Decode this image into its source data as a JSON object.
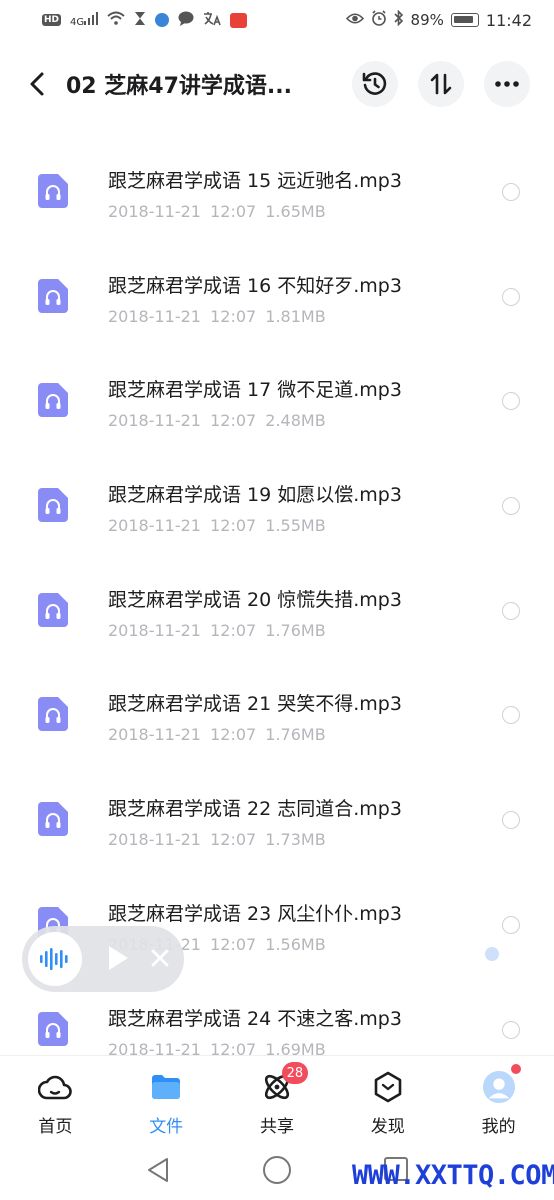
{
  "status_bar": {
    "signal_label": "4G",
    "battery": "89%",
    "time": "11:42"
  },
  "header": {
    "title": "02 芝麻47讲学成语..."
  },
  "files": [
    {
      "name": "跟芝麻君学成语 15 远近驰名.mp3",
      "date": "2018-11-21",
      "time": "12:07",
      "size": "1.65MB"
    },
    {
      "name": "跟芝麻君学成语 16 不知好歹.mp3",
      "date": "2018-11-21",
      "time": "12:07",
      "size": "1.81MB"
    },
    {
      "name": "跟芝麻君学成语 17 微不足道.mp3",
      "date": "2018-11-21",
      "time": "12:07",
      "size": "2.48MB"
    },
    {
      "name": "跟芝麻君学成语 19 如愿以偿.mp3",
      "date": "2018-11-21",
      "time": "12:07",
      "size": "1.55MB"
    },
    {
      "name": "跟芝麻君学成语 20 惊慌失措.mp3",
      "date": "2018-11-21",
      "time": "12:07",
      "size": "1.76MB"
    },
    {
      "name": "跟芝麻君学成语 21 哭笑不得.mp3",
      "date": "2018-11-21",
      "time": "12:07",
      "size": "1.76MB"
    },
    {
      "name": "跟芝麻君学成语 22 志同道合.mp3",
      "date": "2018-11-21",
      "time": "12:07",
      "size": "1.73MB"
    },
    {
      "name": "跟芝麻君学成语 23 风尘仆仆.mp3",
      "date": "2018-11-21",
      "time": "12:07",
      "size": "1.56MB"
    },
    {
      "name": "跟芝麻君学成语 24 不速之客.mp3",
      "date": "2018-11-21",
      "time": "12:07",
      "size": "1.69MB"
    }
  ],
  "bottom_nav": {
    "home": "首页",
    "files": "文件",
    "share": "共享",
    "share_badge": "28",
    "discover": "发现",
    "mine": "我的"
  },
  "watermark": "WWW.XXTTQ.COM",
  "colors": {
    "accent": "#2f8ff6",
    "file_icon": "#8a8cf5",
    "badge": "#f24c5d",
    "watermark": "#1f3fd9"
  }
}
